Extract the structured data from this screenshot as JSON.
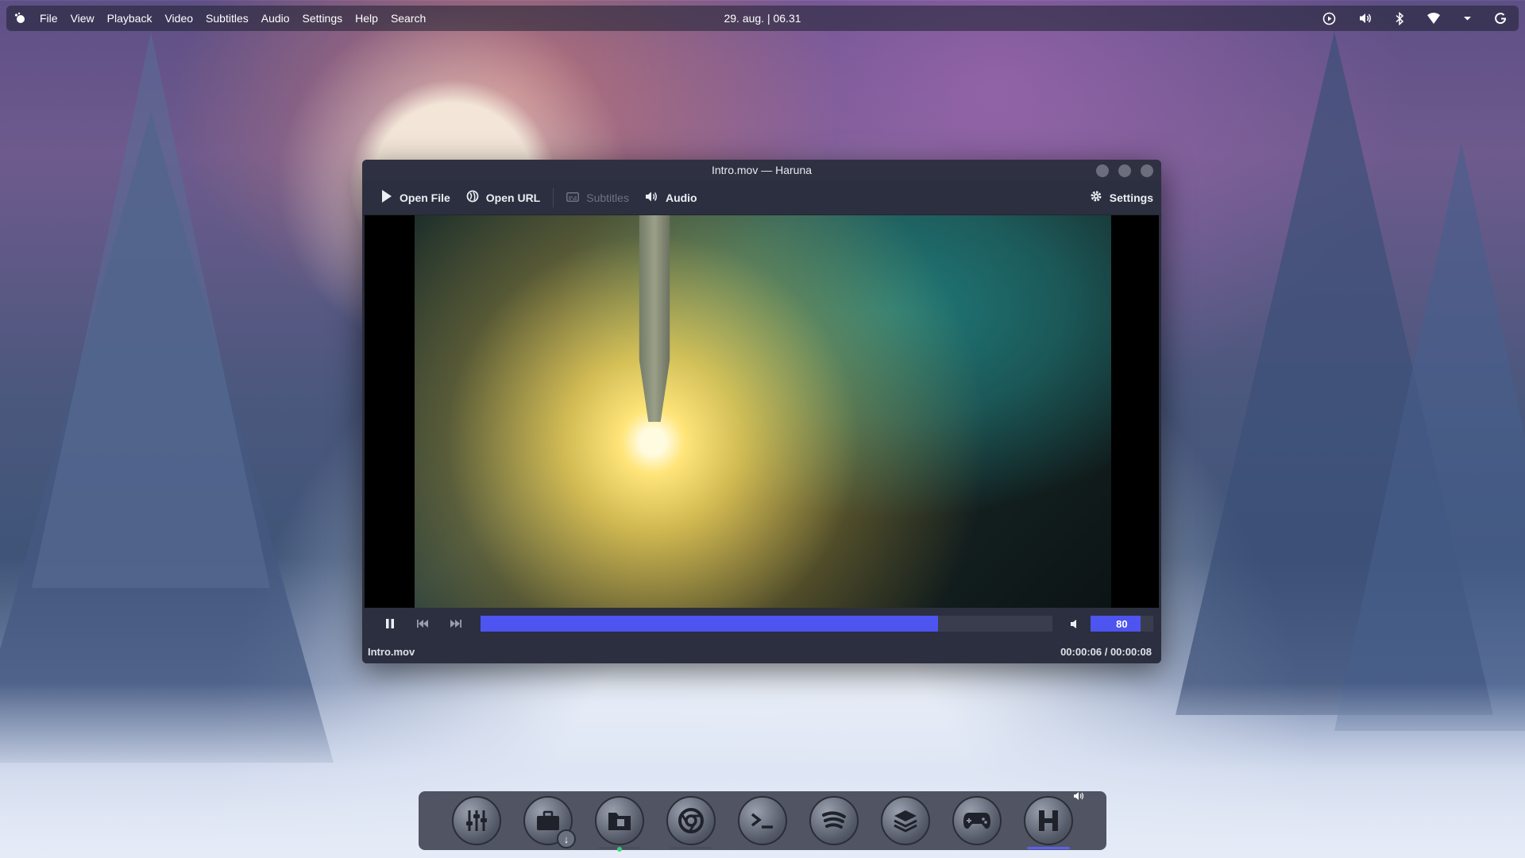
{
  "topbar": {
    "menus": [
      "File",
      "View",
      "Playback",
      "Video",
      "Subtitles",
      "Audio",
      "Settings",
      "Help",
      "Search"
    ],
    "clock": "29. aug. | 06.31",
    "tray_icons": [
      "media-player-icon",
      "volume-icon",
      "bluetooth-icon",
      "wifi-icon",
      "chevron-down-icon",
      "power-icon"
    ]
  },
  "window": {
    "title": "Intro.mov — Haruna",
    "toolbar": {
      "open_file": "Open File",
      "open_url": "Open URL",
      "subtitles": "Subtitles",
      "audio": "Audio",
      "settings": "Settings"
    },
    "playback": {
      "progress": 0.8,
      "volume": "80",
      "volume_level": 0.8
    },
    "status": {
      "filename": "Intro.mov",
      "time": "00:00:06 / 00:00:08"
    }
  },
  "dock": {
    "items": [
      {
        "name": "mixer",
        "icon": "sliders-icon"
      },
      {
        "name": "software-center",
        "icon": "briefcase-download-icon"
      },
      {
        "name": "file-manager",
        "icon": "folder-icon"
      },
      {
        "name": "browser",
        "icon": "chrome-icon"
      },
      {
        "name": "terminal",
        "icon": "terminal-icon"
      },
      {
        "name": "spotify",
        "icon": "spotify-icon"
      },
      {
        "name": "stack",
        "icon": "layers-icon"
      },
      {
        "name": "games",
        "icon": "gamepad-icon"
      },
      {
        "name": "haruna",
        "icon": "haruna-icon"
      }
    ]
  },
  "colors": {
    "accent": "#4d54f0",
    "window_bg": "#2c2f3f"
  }
}
